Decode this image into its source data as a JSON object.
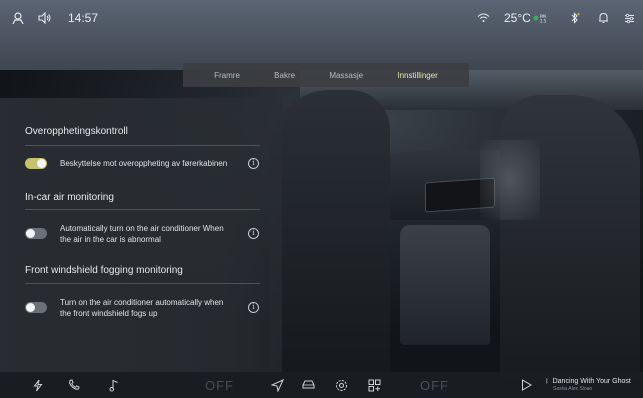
{
  "status_bar": {
    "time": "14:57",
    "temperature": "25°C",
    "icons": [
      "user-icon",
      "volume-icon",
      "wifi-icon",
      "air-quality-icon",
      "bluetooth-icon",
      "notification-bell-icon",
      "settings-sliders-icon"
    ]
  },
  "tabs": [
    {
      "label": "Framre",
      "active": false
    },
    {
      "label": "Bakre",
      "active": false
    },
    {
      "label": "Massasje",
      "active": false
    },
    {
      "label": "Innstillinger",
      "active": true
    }
  ],
  "settings": {
    "section1": {
      "title": "Overopphetingskontroll",
      "row_text": "Beskyttelse mot overoppheting av førerkabinen",
      "toggle_on": true
    },
    "section2": {
      "title": "In-car air monitoring",
      "row_text_1": "Automatically turn on the air conditioner When",
      "row_text_2": "the air in the car is abnormal",
      "toggle_on": false
    },
    "section3": {
      "title": "Front windshield fogging monitoring",
      "row_text_1": "Turn on the air conditioner automatically when",
      "row_text_2": "the front windshield fogs up",
      "toggle_on": false
    },
    "info_glyph": "i"
  },
  "dock": {
    "left_off": "OFF",
    "right_off": "OFF",
    "now_playing": {
      "title": "Dancing With Your Ghost",
      "artist": "Sasha Alex Sloan"
    }
  },
  "colors": {
    "accent": "#e7e8a5",
    "toggle_on": "#c7c270",
    "toggle_off": "#6c7177",
    "panel": "#2a2e33"
  }
}
